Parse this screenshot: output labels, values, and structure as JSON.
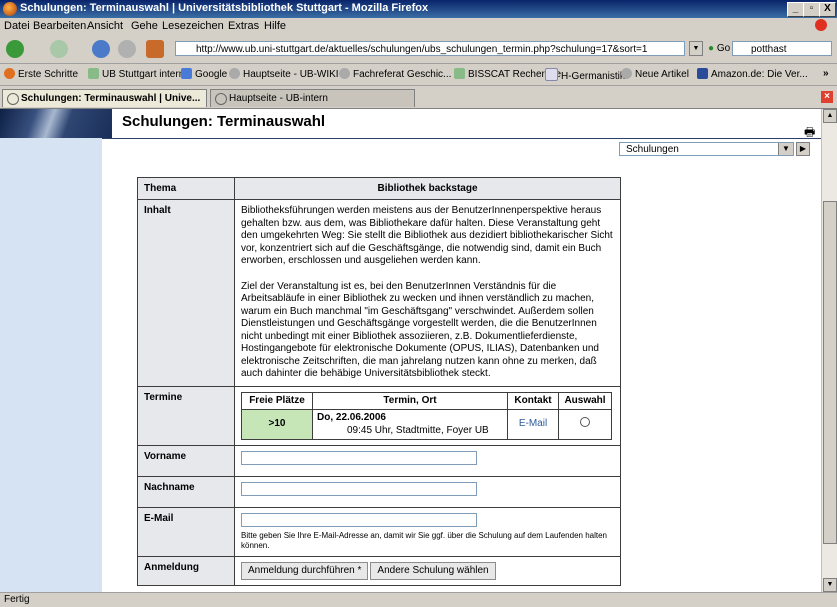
{
  "window": {
    "title": "Schulungen: Terminauswahl | Universitätsbibliothek Stuttgart - Mozilla Firefox",
    "controls": [
      "_",
      "▫",
      "X"
    ]
  },
  "menu": [
    "Datei",
    "Bearbeiten",
    "Ansicht",
    "Gehe",
    "Lesezeichen",
    "Extras",
    "Hilfe"
  ],
  "navigation": {
    "url": "http://www.ub.uni-stuttgart.de/aktuelles/schulungen/ubs_schulungen_termin.php?schulung=17&sort=1",
    "go_label": "Go",
    "search_value": "potthast"
  },
  "bookmarks": [
    {
      "label": "Erste Schritte",
      "icon": "firefox-icon"
    },
    {
      "label": "UB Stuttgart intern",
      "icon": "page-icon"
    },
    {
      "label": "Google",
      "icon": "google-icon"
    },
    {
      "label": "Hauptseite - UB-WIKI",
      "icon": "wiki-icon"
    },
    {
      "label": "Fachreferat Geschic...",
      "icon": "wiki-icon"
    },
    {
      "label": "BISSCAT Recherche",
      "icon": "page-icon"
    },
    {
      "label": "H-Germanistik",
      "icon": "page-icon"
    },
    {
      "label": "Neue Artikel",
      "icon": "wiki-icon"
    },
    {
      "label": "Amazon.de: Die Ver...",
      "icon": "amazon-icon"
    },
    {
      "label": "»",
      "icon": ""
    }
  ],
  "tabs": [
    {
      "label": "Schulungen: Terminauswahl | Unive...",
      "active": true
    },
    {
      "label": "Hauptseite - UB-intern",
      "active": false
    }
  ],
  "page": {
    "title": "Schulungen: Terminauswahl",
    "nav_select": "Schulungen",
    "form": {
      "thema_label": "Thema",
      "thema_value": "Bibliothek backstage",
      "inhalt_label": "Inhalt",
      "inhalt_p1": "Bibliotheksführungen werden meistens aus der BenutzerInnenperspektive heraus gehalten bzw. aus dem, was Bibliothekare dafür halten. Diese Veranstaltung geht den umgekehrten Weg: Sie stellt die Bibliothek aus dezidiert bibliothekarischer Sicht vor, konzentriert sich auf die Geschäftsgänge, die notwendig sind, damit ein Buch erworben, erschlossen und ausgeliehen werden kann.",
      "inhalt_p2": "Ziel der Veranstaltung ist es, bei den BenutzerInnen Verständnis für die Arbeitsabläufe in einer Bibliothek zu wecken und ihnen verständlich zu machen, warum ein Buch manchmal \"im Geschäftsgang\" verschwindet. Außerdem sollen Dienstleistungen und Geschäftsgänge vorgestellt werden, die die BenutzerInnen nicht unbedingt mit einer Bibliothek assoziieren, z.B. Dokumentlieferdienste, Hostingangebote für elektronische Dokumente (OPUS, ILIAS), Datenbanken und elektronische Zeitschriften, die man jahrelang nutzen kann ohne zu merken, daß auch dahinter die behäbige Universitätsbibliothek steckt.",
      "termine_label": "Termine",
      "termine_headers": [
        "Freie Plätze",
        "Termin, Ort",
        "Kontakt",
        "Auswahl"
      ],
      "termin_row": {
        "plaetze": ">10",
        "datum": "Do, 22.06.2006",
        "ort": "09:45 Uhr, Stadtmitte, Foyer UB",
        "kontakt": "E-Mail"
      },
      "vorname_label": "Vorname",
      "nachname_label": "Nachname",
      "email_label": "E-Mail",
      "email_hint": "Bitte geben Sie Ihre E-Mail-Adresse an, damit wir Sie ggf. über die Schulung auf dem Laufenden halten können.",
      "anmeldung_label": "Anmeldung",
      "submit_label": "Anmeldung durchführen *",
      "other_label": "Andere Schulung wählen"
    }
  },
  "status": "Fertig",
  "colors": {
    "titlebar": "#0a246a",
    "sidebar": "#d6e3f2",
    "free_cell": "#c7e6b8",
    "label_cell": "#e6e8ec"
  }
}
